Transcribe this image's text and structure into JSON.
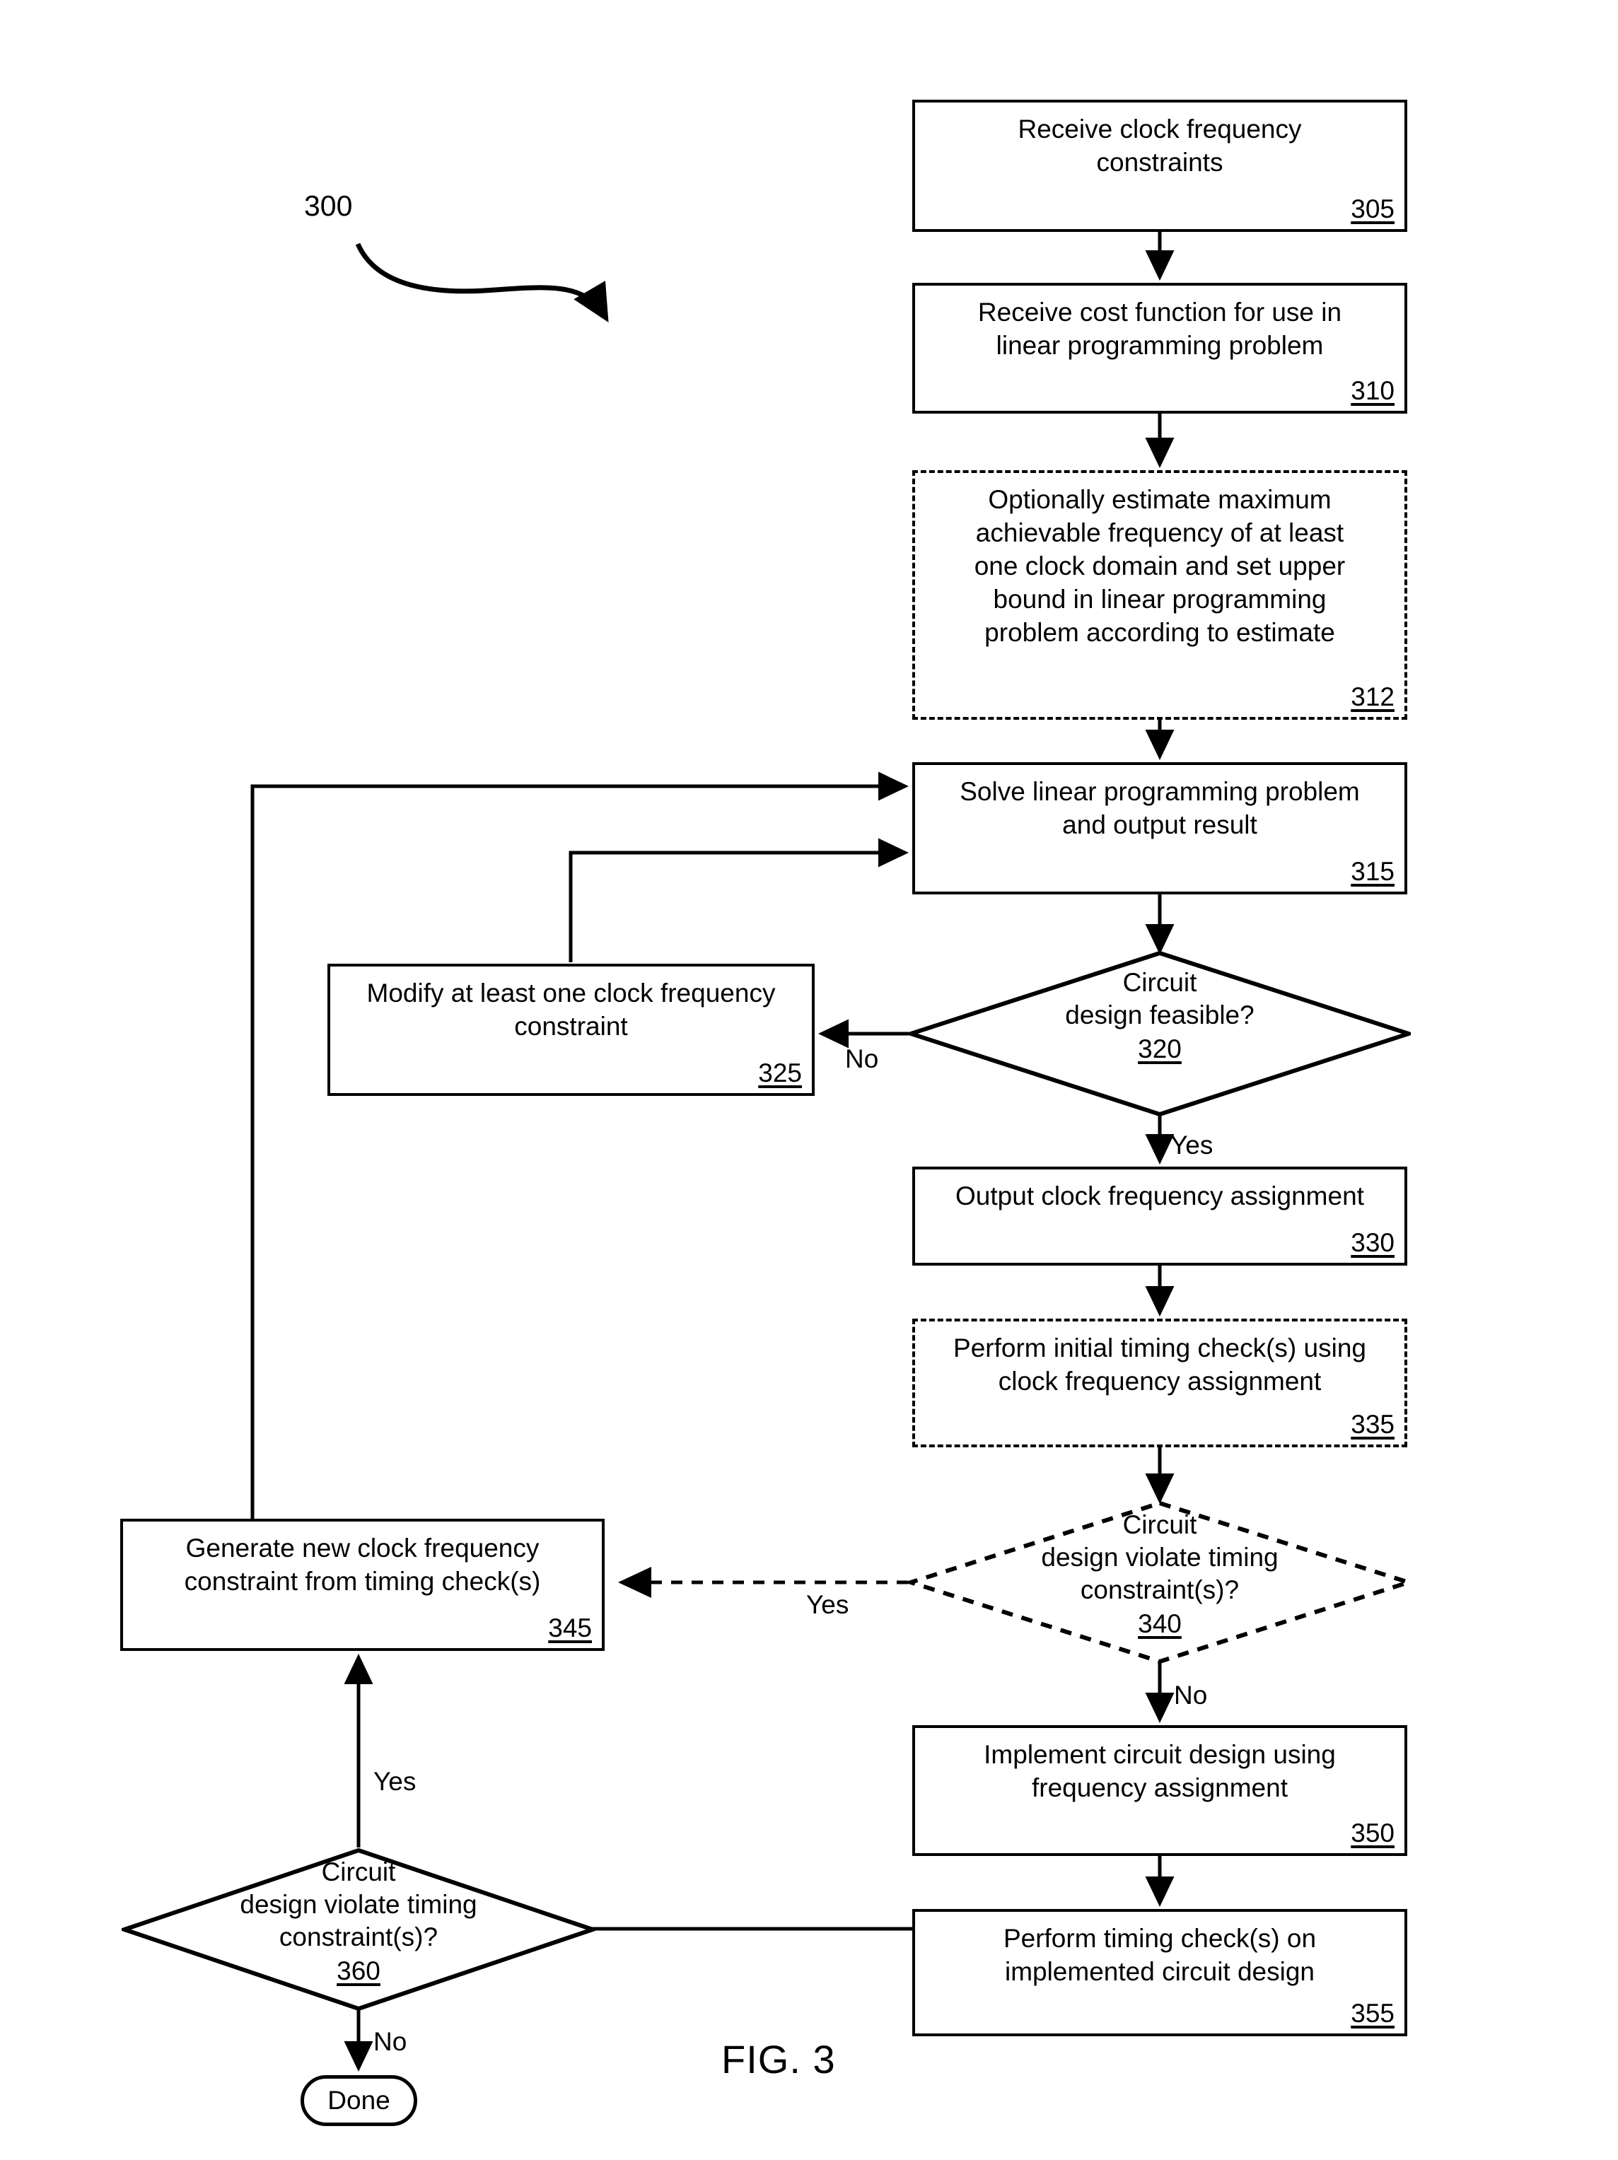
{
  "figure": {
    "label": "FIG. 3",
    "flow_reference": "300"
  },
  "nodes": {
    "n305": {
      "text": "Receive clock frequency\nconstraints",
      "ref": "305",
      "shape": "process",
      "style": "solid"
    },
    "n310": {
      "text": "Receive cost function for use in\nlinear programming problem",
      "ref": "310",
      "shape": "process",
      "style": "solid"
    },
    "n312": {
      "text": "Optionally estimate maximum\nachievable frequency of at least\none clock domain and set upper\nbound in linear programming\nproblem according to estimate",
      "ref": "312",
      "shape": "process",
      "style": "dashed"
    },
    "n315": {
      "text": "Solve linear programming problem\nand output result",
      "ref": "315",
      "shape": "process",
      "style": "solid"
    },
    "n320": {
      "text": "Circuit\ndesign feasible?",
      "ref": "320",
      "shape": "decision",
      "style": "solid"
    },
    "n325": {
      "text": "Modify at least one clock frequency\nconstraint",
      "ref": "325",
      "shape": "process",
      "style": "solid"
    },
    "n330": {
      "text": "Output clock frequency assignment",
      "ref": "330",
      "shape": "process",
      "style": "solid"
    },
    "n335": {
      "text": "Perform initial timing check(s) using\nclock frequency assignment",
      "ref": "335",
      "shape": "process",
      "style": "dashed"
    },
    "n340": {
      "text": "Circuit\ndesign violate timing\nconstraint(s)?",
      "ref": "340",
      "shape": "decision",
      "style": "dashed"
    },
    "n345": {
      "text": "Generate new clock frequency\nconstraint from timing check(s)",
      "ref": "345",
      "shape": "process",
      "style": "solid"
    },
    "n350": {
      "text": "Implement circuit design using\nfrequency assignment",
      "ref": "350",
      "shape": "process",
      "style": "solid"
    },
    "n355": {
      "text": "Perform timing check(s) on\nimplemented circuit design",
      "ref": "355",
      "shape": "process",
      "style": "solid"
    },
    "n360": {
      "text": "Circuit\ndesign violate timing\nconstraint(s)?",
      "ref": "360",
      "shape": "decision",
      "style": "solid"
    },
    "nDone": {
      "text": "Done",
      "shape": "terminal",
      "style": "solid"
    }
  },
  "edge_labels": {
    "e320_no": "No",
    "e320_yes": "Yes",
    "e340_yes": "Yes",
    "e340_no": "No",
    "e360_yes": "Yes",
    "e360_no": "No"
  },
  "colors": {
    "stroke": "#000000",
    "background": "#ffffff"
  }
}
